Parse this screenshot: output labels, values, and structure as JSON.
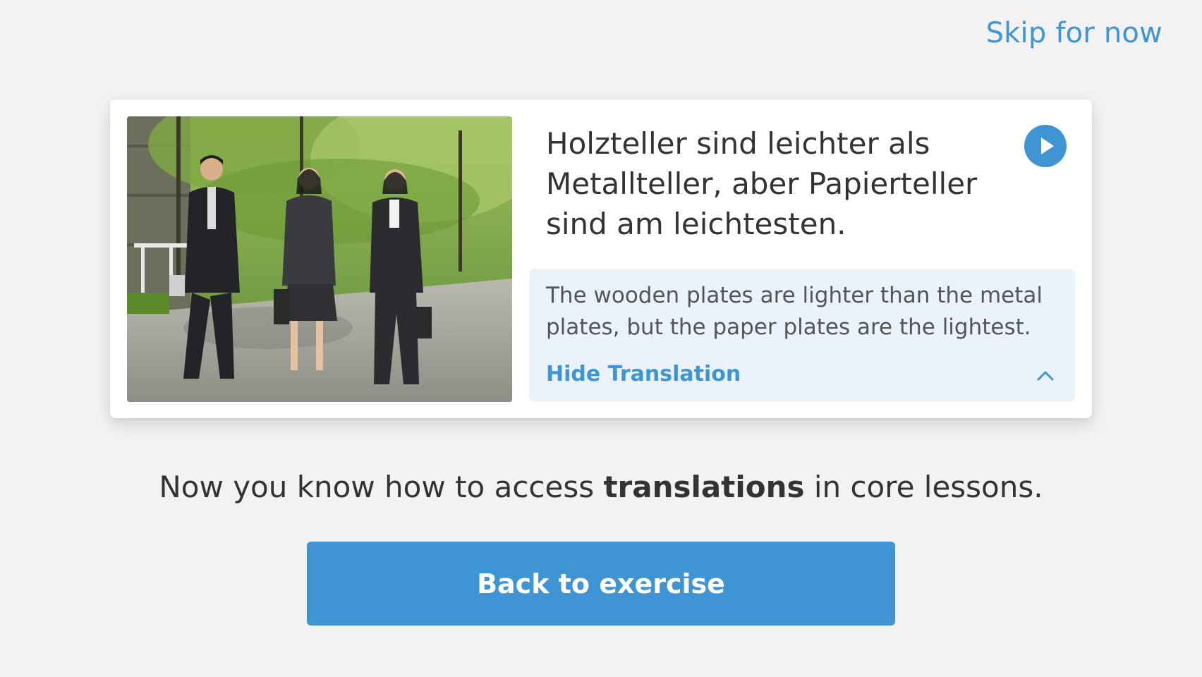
{
  "header": {
    "skip_label": "Skip for now"
  },
  "card": {
    "sentence": "Holzteller sind leichter als Metallteller, aber Papierteller sind am leichtesten.",
    "translation": "The wooden plates are lighter than the metal plates, but the paper plates are the lightest.",
    "hide_translation_label": "Hide Translation",
    "play_icon": "play-icon",
    "chevron_icon": "chevron-up-icon"
  },
  "message": {
    "before": "Now you know how to access ",
    "highlight": "translations",
    "after": " in core lessons."
  },
  "actions": {
    "back_label": "Back to exercise"
  },
  "colors": {
    "accent": "#3f95d4",
    "background": "#f2f2f2",
    "translation_bg": "#eaf3fb",
    "text": "#333333"
  }
}
